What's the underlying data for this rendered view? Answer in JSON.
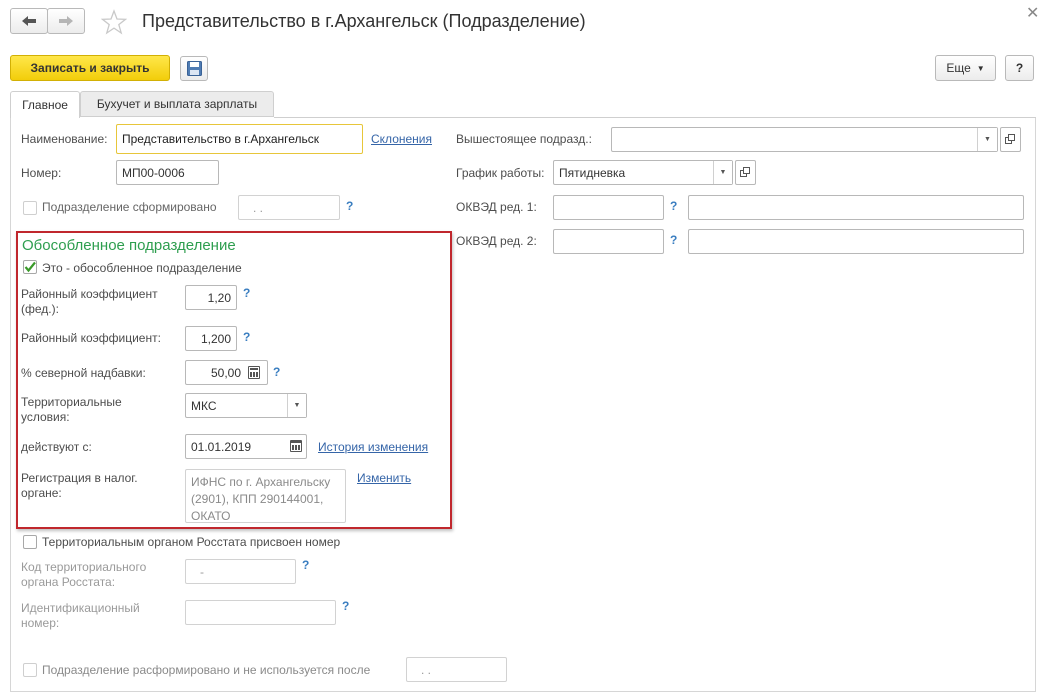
{
  "window": {
    "title": "Представительство в г.Архангельск (Подразделение)",
    "close_icon": "close-icon",
    "back_icon": "arrow-left-icon",
    "forward_icon": "arrow-right-icon",
    "favorite_icon": "star-icon"
  },
  "toolbar": {
    "save_close_label": "Записать и закрыть",
    "save_icon": "floppy-disk-icon",
    "more_label": "Еще",
    "help_label": "?"
  },
  "tabs": [
    {
      "label": "Главное",
      "active": true
    },
    {
      "label": "Бухучет и выплата зарплаты",
      "active": false
    }
  ],
  "form": {
    "name_label": "Наименование:",
    "name_value": "Представительство в г.Архангельск",
    "declensions_link": "Склонения",
    "number_label": "Номер:",
    "number_value": "МП00-0006",
    "formed_label": "Подразделение сформировано",
    "formed_date": ". .",
    "help_mark": "?",
    "parent_label": "Вышестоящее подразд.:",
    "parent_value": "",
    "schedule_label": "График работы:",
    "schedule_value": "Пятидневка",
    "okved1_label": "ОКВЭД ред. 1:",
    "okved2_label": "ОКВЭД ред. 2:"
  },
  "separate": {
    "group_title": "Обособленное подразделение",
    "is_separate_label": "Это - обособленное подразделение",
    "is_separate_checked": true,
    "district_coef_fed_label": "Районный коэффициент (фед.):",
    "district_coef_fed_value": "1,20",
    "district_coef_label": "Районный коэффициент:",
    "district_coef_value": "1,200",
    "north_bonus_label": "% северной надбавки:",
    "north_bonus_value": "50,00",
    "territorial_label": "Территориальные условия:",
    "territorial_value": "МКС",
    "valid_from_label": "действуют с:",
    "valid_from_value": "01.01.2019",
    "history_link": "История изменения",
    "tax_reg_label": "Регистрация в налог. органе:",
    "tax_reg_value": "ИФНС по г. Архангельску (2901), КПП 290144001, ОКАТО",
    "change_link": "Изменить"
  },
  "rosstat": {
    "assigned_label": "Территориальным органом Росстата присвоен номер",
    "code_label": "Код территориального органа Росстата:",
    "code_value": "-",
    "id_label": "Идентификационный номер:",
    "id_value": ""
  },
  "disbanded": {
    "label": "Подразделение расформировано и не используется после",
    "date": ". ."
  },
  "colors": {
    "accent_yellow": "#f6d514",
    "group_title_green": "#2e9e4f",
    "highlight_red": "#c0272d",
    "link_blue": "#3565a8",
    "checkmark_green": "#3a9a2a"
  }
}
